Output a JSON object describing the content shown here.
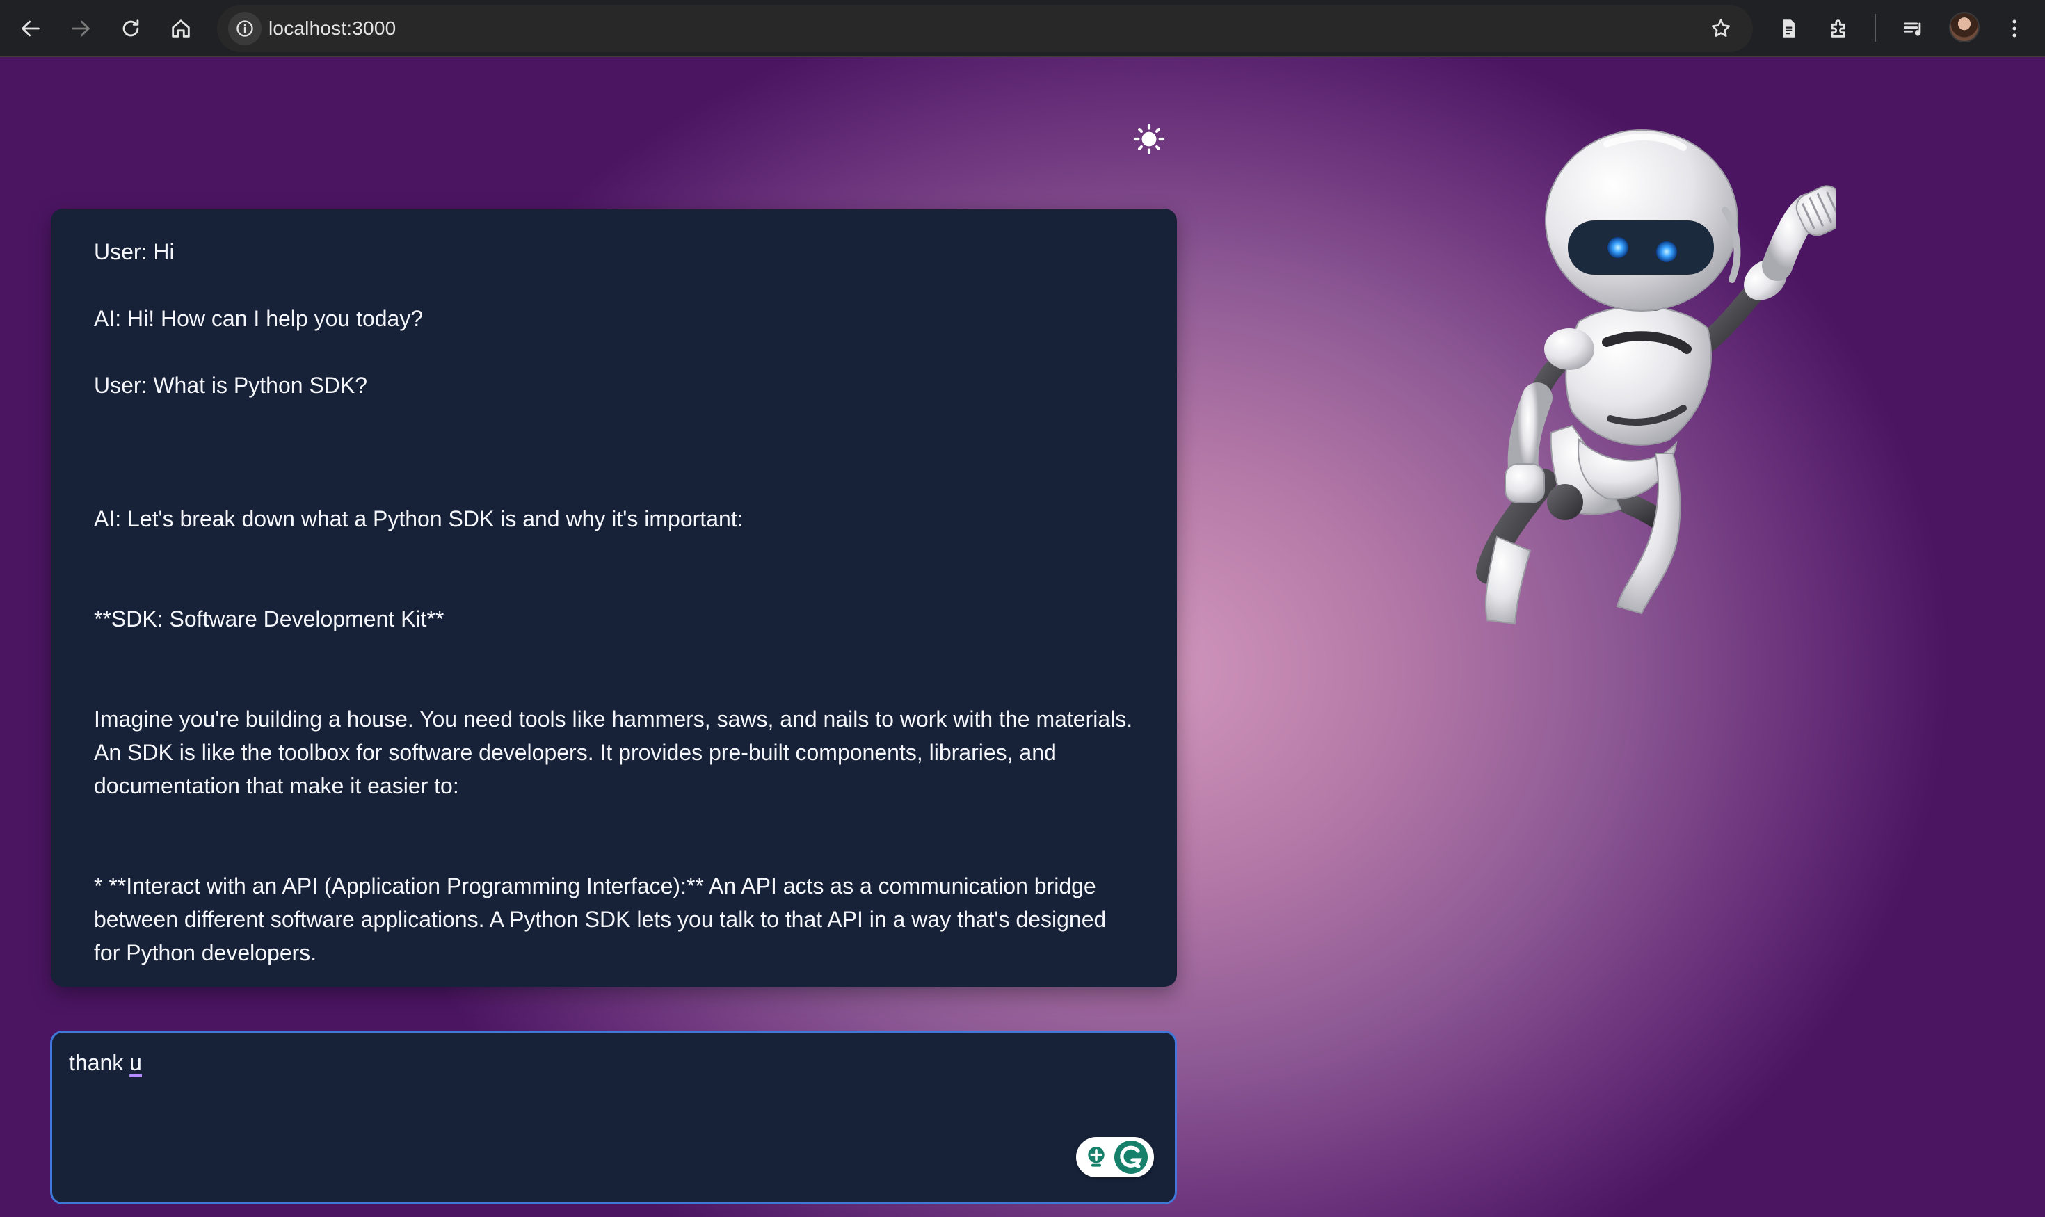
{
  "browser": {
    "url": "localhost:3000",
    "toolbar_icons": [
      "back-icon",
      "forward-icon",
      "reload-icon",
      "home-icon",
      "site-info-icon",
      "bookmark-star-icon",
      "reading-list-icon",
      "extensions-icon",
      "media-control-icon",
      "profile-avatar",
      "more-menu-icon"
    ]
  },
  "page": {
    "theme_toggle_icon": "sun-icon",
    "accent_color": "#3f78d8",
    "panel_color": "#172239"
  },
  "chat": {
    "messages": [
      "User: Hi",
      "AI: Hi! How can I help you today?",
      "User: What is Python SDK?",
      "AI: Let's break down what a Python SDK is and why it's important:",
      "**SDK: Software Development Kit**",
      "Imagine you're building a house. You need tools like hammers, saws, and nails to work with the materials. An SDK is like the toolbox for software developers. It provides pre-built components, libraries, and documentation that make it easier to:",
      "* **Interact with an API (Application Programming Interface):** An API acts as a communication bridge between different software applications. A Python SDK lets you talk to that API in a way that's designed for Python developers."
    ]
  },
  "input": {
    "value_prefix": "thank ",
    "value_flagged": "u",
    "assistant_icons": [
      "grammarly-suggestion-icon",
      "grammarly-logo-icon"
    ]
  }
}
